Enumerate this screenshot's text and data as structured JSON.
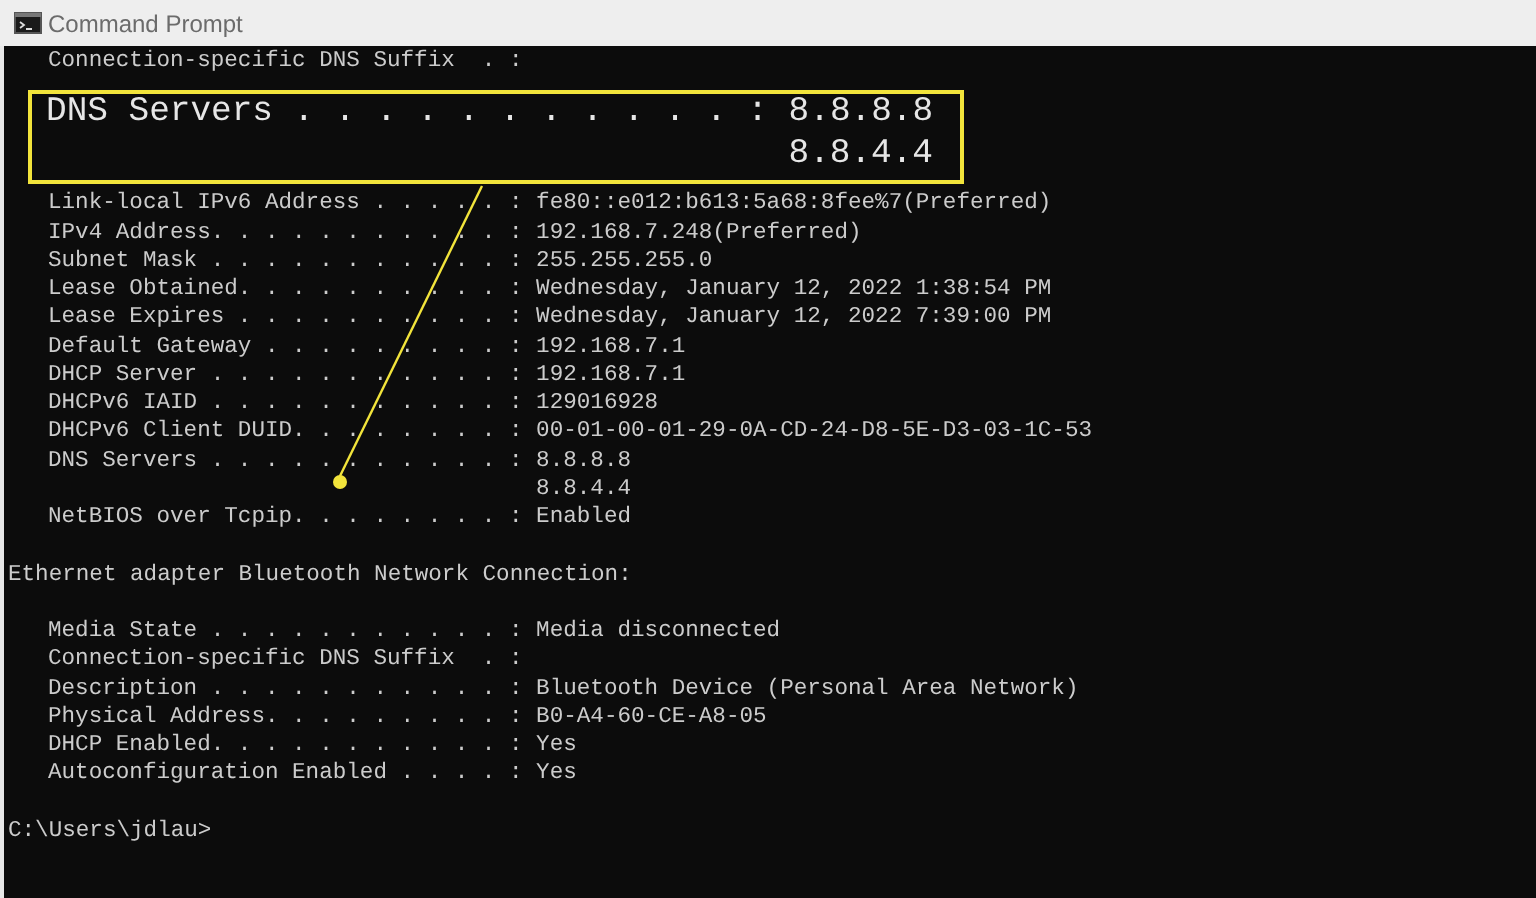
{
  "window": {
    "title": "Command Prompt"
  },
  "output": [
    {
      "kind": "entry",
      "text": "Connection-specific DNS Suffix  . :"
    },
    {
      "kind": "blank"
    },
    {
      "kind": "blank"
    },
    {
      "kind": "blank"
    },
    {
      "kind": "blank"
    },
    {
      "kind": "entry",
      "text": "Link-local IPv6 Address . . . . . : fe80::e012:b613:5a68:8fee%7(Preferred)"
    },
    {
      "kind": "entry",
      "text": "IPv4 Address. . . . . . . . . . . : 192.168.7.248(Preferred)"
    },
    {
      "kind": "entry",
      "text": "Subnet Mask . . . . . . . . . . . : 255.255.255.0"
    },
    {
      "kind": "entry",
      "text": "Lease Obtained. . . . . . . . . . : Wednesday, January 12, 2022 1:38:54 PM"
    },
    {
      "kind": "entry",
      "text": "Lease Expires . . . . . . . . . . : Wednesday, January 12, 2022 7:39:00 PM"
    },
    {
      "kind": "entry",
      "text": "Default Gateway . . . . . . . . . : 192.168.7.1"
    },
    {
      "kind": "entry",
      "text": "DHCP Server . . . . . . . . . . . : 192.168.7.1"
    },
    {
      "kind": "entry",
      "text": "DHCPv6 IAID . . . . . . . . . . . : 129016928"
    },
    {
      "kind": "entry",
      "text": "DHCPv6 Client DUID. . . . . . . . : 00-01-00-01-29-0A-CD-24-D8-5E-D3-03-1C-53"
    },
    {
      "kind": "entry",
      "text": "DNS Servers . . . . . . . . . . . : 8.8.8.8"
    },
    {
      "kind": "continuation",
      "text": "8.8.4.4"
    },
    {
      "kind": "entry",
      "text": "NetBIOS over Tcpip. . . . . . . . : Enabled"
    },
    {
      "kind": "blank"
    },
    {
      "kind": "heading",
      "text": "Ethernet adapter Bluetooth Network Connection:"
    },
    {
      "kind": "blank"
    },
    {
      "kind": "entry",
      "text": "Media State . . . . . . . . . . . : Media disconnected"
    },
    {
      "kind": "entry",
      "text": "Connection-specific DNS Suffix  . :"
    },
    {
      "kind": "entry",
      "text": "Description . . . . . . . . . . . : Bluetooth Device (Personal Area Network)"
    },
    {
      "kind": "entry",
      "text": "Physical Address. . . . . . . . . : B0-A4-60-CE-A8-05"
    },
    {
      "kind": "entry",
      "text": "DHCP Enabled. . . . . . . . . . . : Yes"
    },
    {
      "kind": "entry",
      "text": "Autoconfiguration Enabled . . . . : Yes"
    },
    {
      "kind": "blank"
    },
    {
      "kind": "prompt",
      "text": "C:\\Users\\jdlau>"
    }
  ],
  "callout": {
    "label": "DNS Servers . . . . . . . . . . . : 8.8.8.8",
    "continuation": "8.8.4.4"
  }
}
